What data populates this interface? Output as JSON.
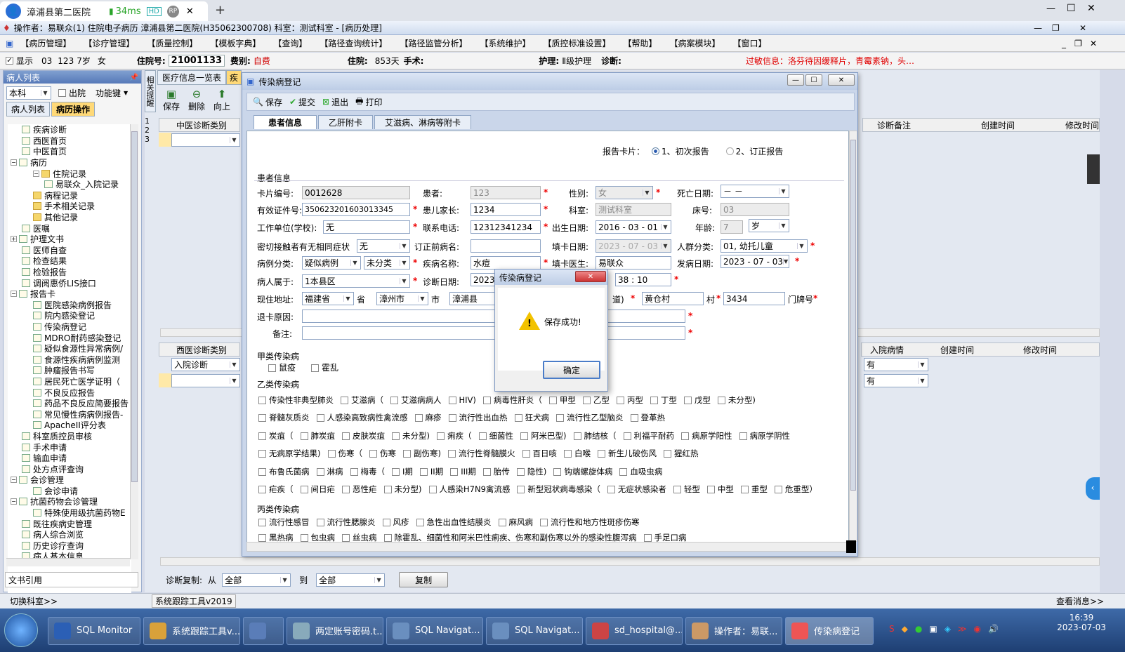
{
  "browser": {
    "tab_title": "漳浦县第二医院",
    "latency": "34ms",
    "hd": "HD",
    "rp": "RP",
    "close": "✕",
    "new_tab": "+",
    "win_min": "—",
    "win_max": "☐",
    "win_close": "✕"
  },
  "app": {
    "title": "操作者：易联众(1) 住院电子病历  漳浦县第二医院(H35062300708)  科室：测试科室 - [病历处理]"
  },
  "menu": [
    "【病历管理】",
    "【诊疗管理】",
    "【质量控制】",
    "【模板字典】",
    "【查询】",
    "【路径查询统计】",
    "【路径监管分析】",
    "【系统维护】",
    "【质控标准设置】",
    "【帮助】",
    "【病案模块】",
    "【窗口】"
  ],
  "patient_bar": {
    "show_label": "显示",
    "bed": "03",
    "pid": "123",
    "age": "7岁",
    "sex": "女",
    "admission_no_label": "住院号:",
    "admission_no": "21001133",
    "fee_label": "费别:",
    "fee": "自费",
    "hospitalized_label": "住院:",
    "hospitalized": "853天",
    "surgery_label": "手术:",
    "nursing_label": "护理:",
    "nursing": "Ⅱ级护理",
    "diagnosis_label": "诊断:",
    "allergy": "过敏信息：洛芬待因缓释片，青霉素钠，头…"
  },
  "left": {
    "header": "病人列表",
    "dept": "本科",
    "discharged": "出院",
    "func_key": "功能键",
    "tab_patients": "病人列表",
    "tab_records": "病历操作",
    "tree": [
      {
        "label": "疾病诊断",
        "indent": 1,
        "icon": "check"
      },
      {
        "label": "西医首页",
        "indent": 1,
        "icon": "doc"
      },
      {
        "label": "中医首页",
        "indent": 1,
        "icon": "doc"
      },
      {
        "label": "病历",
        "indent": 0,
        "icon": "doc",
        "toggle": "−"
      },
      {
        "label": "住院记录",
        "indent": 2,
        "icon": "folder",
        "toggle": "−"
      },
      {
        "label": "易联众_入院记录",
        "indent": 3,
        "icon": "doc"
      },
      {
        "label": "病程记录",
        "indent": 2,
        "icon": "folder"
      },
      {
        "label": "手术相关记录",
        "indent": 2,
        "icon": "folder"
      },
      {
        "label": "其他记录",
        "indent": 2,
        "icon": "folder"
      },
      {
        "label": "医嘱",
        "indent": 1,
        "icon": "doc"
      },
      {
        "label": "护理文书",
        "indent": 0,
        "icon": "doc",
        "toggle": "+"
      },
      {
        "label": "医师自查",
        "indent": 1,
        "icon": "doc"
      },
      {
        "label": "检查结果",
        "indent": 1,
        "icon": "doc"
      },
      {
        "label": "检验报告",
        "indent": 1,
        "icon": "doc"
      },
      {
        "label": "调阅惠侨LIS接口",
        "indent": 1,
        "icon": "doc"
      },
      {
        "label": "报告卡",
        "indent": 0,
        "icon": "doc",
        "toggle": "−"
      },
      {
        "label": "医院感染病例报告",
        "indent": 2,
        "icon": "doc"
      },
      {
        "label": "院内感染登记",
        "indent": 2,
        "icon": "doc"
      },
      {
        "label": "传染病登记",
        "indent": 2,
        "icon": "doc"
      },
      {
        "label": "MDRO耐药感染登记",
        "indent": 2,
        "icon": "doc"
      },
      {
        "label": "疑似食源性异常病例/",
        "indent": 2,
        "icon": "doc"
      },
      {
        "label": "食源性疾病病例监测",
        "indent": 2,
        "icon": "doc"
      },
      {
        "label": "肿瘤报告书写",
        "indent": 2,
        "icon": "doc"
      },
      {
        "label": "居民死亡医学证明（",
        "indent": 2,
        "icon": "doc"
      },
      {
        "label": "不良反应报告",
        "indent": 2,
        "icon": "doc"
      },
      {
        "label": "药品不良反应简要报告",
        "indent": 2,
        "icon": "doc"
      },
      {
        "label": "常见慢性病病例报告-",
        "indent": 2,
        "icon": "doc"
      },
      {
        "label": "ApacheII评分表",
        "indent": 2,
        "icon": "doc"
      },
      {
        "label": "科室质控员审核",
        "indent": 1,
        "icon": "doc"
      },
      {
        "label": "手术申请",
        "indent": 1,
        "icon": "doc"
      },
      {
        "label": "输血申请",
        "indent": 1,
        "icon": "doc"
      },
      {
        "label": "处方点评查询",
        "indent": 1,
        "icon": "doc"
      },
      {
        "label": "会诊管理",
        "indent": 0,
        "icon": "doc",
        "toggle": "−"
      },
      {
        "label": "会诊申请",
        "indent": 2,
        "icon": "doc"
      },
      {
        "label": "抗菌药物会诊管理",
        "indent": 0,
        "icon": "doc",
        "toggle": "−"
      },
      {
        "label": "特殊使用级抗菌药物E",
        "indent": 2,
        "icon": "doc"
      },
      {
        "label": "既往疾病史管理",
        "indent": 1,
        "icon": "doc"
      },
      {
        "label": "病人综合浏览",
        "indent": 1,
        "icon": "doc"
      },
      {
        "label": "历史诊疗查询",
        "indent": 1,
        "icon": "doc"
      },
      {
        "label": "病人基本信息",
        "indent": 1,
        "icon": "doc"
      }
    ],
    "doc_ref": "文书引用"
  },
  "middle": {
    "side_tab": "相关提醒",
    "tab_overview": "医疗信息一览表",
    "tab_disease": "疾",
    "toolbar": {
      "save": "保存",
      "delete": "删除",
      "up": "向上"
    },
    "row_nums": [
      "1",
      "2",
      "3"
    ],
    "tcm_col": "中医诊断类别",
    "col_note": "诊断备注",
    "col_created": "创建时间",
    "col_modified": "修改时间",
    "wm_col": "西医诊断类别",
    "wm_value": "入院诊断",
    "col_admit": "入院病情",
    "admit_val_1": "有",
    "admit_val_2": "有",
    "copy_label": "诊断复制:",
    "from_label": "从",
    "from_val": "全部",
    "to_label": "到",
    "to_val": "全部",
    "copy_btn": "复制"
  },
  "dialog": {
    "title": "传染病登记",
    "toolbar": {
      "save": "保存",
      "submit": "提交",
      "exit": "退出",
      "print": "打印"
    },
    "tabs": [
      "患者信息",
      "乙肝附卡",
      "艾滋病、淋病等附卡"
    ],
    "report_card_label": "报告卡片：",
    "report_opt1": "1、初次报告",
    "report_opt2": "2、订正报告",
    "section_patient": "患者信息",
    "card_no_label": "卡片编号:",
    "card_no": "0012628",
    "patient_label": "患者:",
    "patient": "123",
    "gender_label": "性别:",
    "gender": "女",
    "death_label": "死亡日期:",
    "death": "－  －",
    "id_label": "有效证件号:",
    "id": "350623201603013345",
    "parent_label": "患儿家长:",
    "parent": "1234",
    "dept_label": "科室:",
    "dept": "测试科室",
    "bed_label": "床号:",
    "bed": "03",
    "work_label": "工作单位(学校):",
    "work": "无",
    "phone_label": "联系电话:",
    "phone": "12312341234",
    "birth_label": "出生日期:",
    "birth": "2016 - 03 - 01",
    "age_label": "年龄:",
    "age": "7",
    "age_unit": "岁",
    "contact_label": "密切接触者有无相同症状",
    "contact": "无",
    "revised_label": "订正前病名:",
    "fill_date_label": "填卡日期:",
    "fill_date": "2023 - 07 - 03",
    "crowd_label": "人群分类:",
    "crowd": "01, 幼托儿童",
    "case_type_label": "病例分类:",
    "case_type": "疑似病例",
    "case_sub": "未分类",
    "disease_label": "疾病名称:",
    "disease": "水痘",
    "doctor_label": "填卡医生:",
    "doctor": "易联众",
    "onset_label": "发病日期:",
    "onset": "2023 - 07 - 03",
    "belong_label": "病人属于:",
    "belong": "1本县区",
    "diag_date_label": "诊断日期:",
    "diag_date": "2023",
    "diag_time": "38 : 10",
    "addr_label": "现住地址:",
    "province": "福建省",
    "province_sfx": "省",
    "city": "漳州市",
    "city_sfx": "市",
    "county": "漳浦县",
    "street_sfx": "道)",
    "village": "黄仓村",
    "village_sfx": "村",
    "house": "3434",
    "house_sfx": "门牌号",
    "return_label": "退卡原因:",
    "note_label": "备注:",
    "class_a": "甲类传染病",
    "class_a_items": [
      "鼠疫",
      "霍乱"
    ],
    "class_b": "乙类传染病",
    "class_b_rows": [
      [
        "传染性非典型肺炎",
        "艾滋病（",
        "艾滋病病人",
        "HIV)",
        "病毒性肝炎（",
        "甲型",
        "乙型",
        "丙型",
        "丁型",
        "戊型",
        "未分型)"
      ],
      [
        "脊髓灰质炎",
        "人感染高致病性禽流感",
        "麻疹",
        "流行性出血热",
        "狂犬病",
        "流行性乙型脑炎",
        "登革热"
      ],
      [
        "炭疽（",
        "肺炭疽",
        "皮肤炭疽",
        "未分型)",
        "痢疾（",
        "细菌性",
        "阿米巴型)",
        "肺结核（",
        "利福平耐药",
        "病原学阳性",
        "病原学阴性"
      ],
      [
        "无病原学结果)",
        "伤寒（",
        "伤寒",
        "副伤寒)",
        "流行性脊髓膜火",
        "百日咳",
        "白喉",
        "新生儿破伤风",
        "猩红热"
      ],
      [
        "布鲁氏菌病",
        "淋病",
        "梅毒（",
        "I期",
        "II期",
        "III期",
        "胎传",
        "隐性)",
        "钩端螺旋体病",
        "血吸虫病"
      ],
      [
        "疟疾（",
        "间日疟",
        "恶性疟",
        "未分型)",
        "人感染H7N9禽流感",
        "新型冠状病毒感染（",
        "无症状感染者",
        "轻型",
        "中型",
        "重型",
        "危重型）"
      ]
    ],
    "class_c": "丙类传染病",
    "class_c_rows": [
      [
        "流行性感冒",
        "流行性腮腺炎",
        "风疹",
        "急性出血性结膜炎",
        "麻风病",
        "流行性和地方性斑疹伤寒"
      ],
      [
        "黑热病",
        "包虫病",
        "丝虫病",
        "除霍乱、细菌性和阿米巴性痢疾、伤寒和副伤寒以外的感染性腹泻病",
        "手足口病"
      ]
    ]
  },
  "msgbox": {
    "title": "传染病登记",
    "message": "保存成功!",
    "ok": "确定"
  },
  "status": {
    "switch_dept": "切换科室>>",
    "tool": "系统跟踪工具v2019",
    "view_msg": "查看消息>>"
  },
  "taskbar": {
    "items": [
      "SQL Monitor",
      "系统跟踪工具v...",
      "",
      "两定账号密码.t...",
      "SQL Navigat...",
      "SQL Navigat...",
      "sd_hospital@...",
      "操作者：易联...",
      "传染病登记"
    ],
    "time": "16:39",
    "date": "2023-07-03"
  },
  "colors": {
    "accent": "#5679b8",
    "required": "#e00000",
    "allergy": "#e00000",
    "fee": "#d00000",
    "yellow_row": "#ffe9a8"
  }
}
